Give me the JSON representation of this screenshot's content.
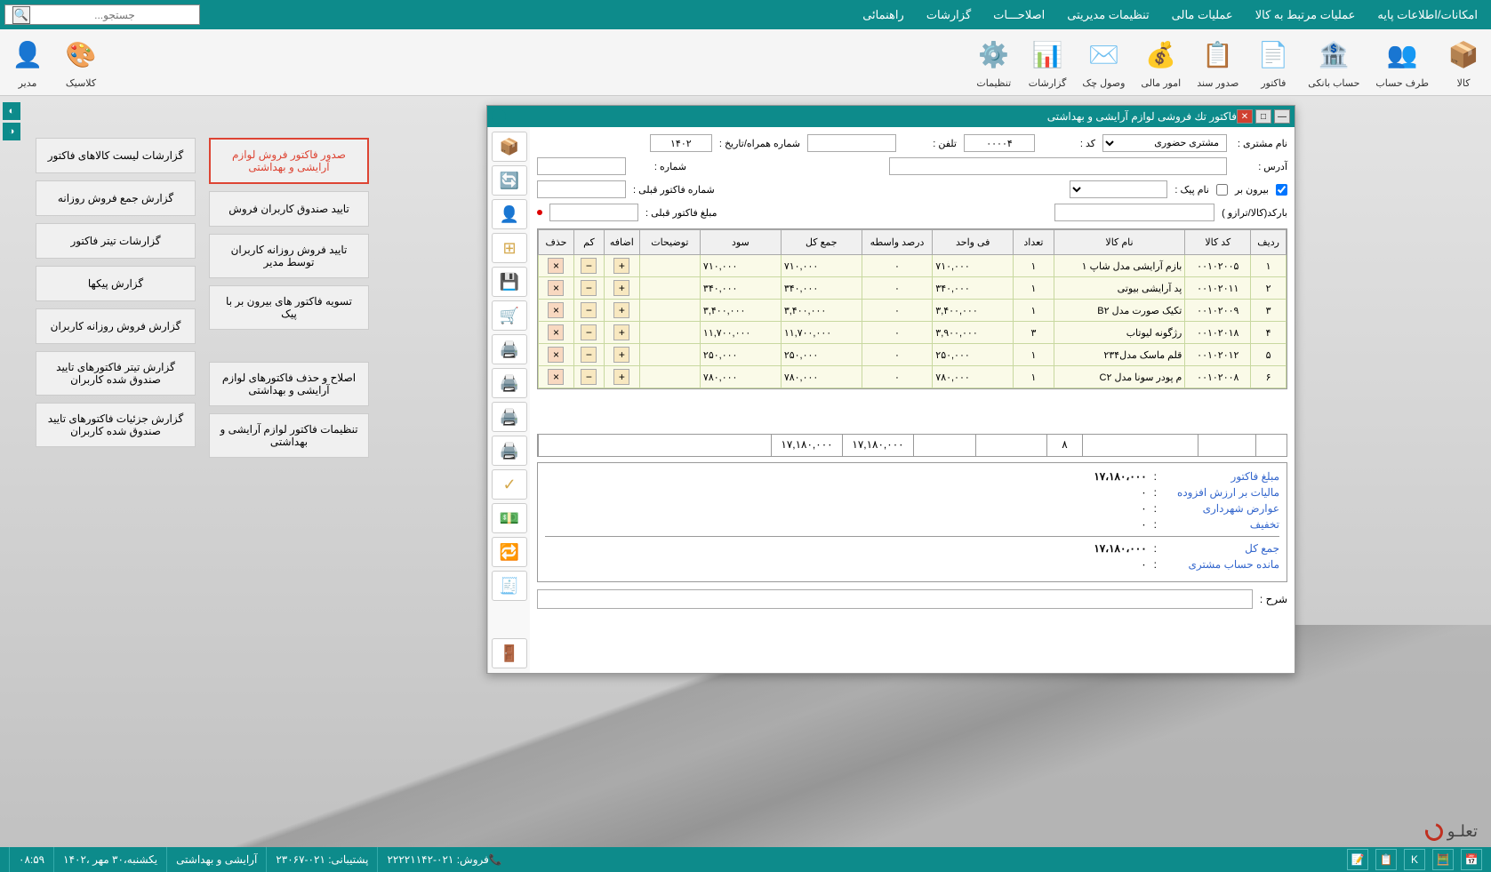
{
  "topMenu": [
    "امکانات/اطلاعات پایه",
    "عملیات مرتبط به کالا",
    "عملیات مالی",
    "تنظیمات مدیریتی",
    "اصلاحـــات",
    "گزارشات",
    "راهنمائی"
  ],
  "searchPlaceholder": "جستجو...",
  "ribbon": [
    {
      "label": "کالا",
      "icon": "📦"
    },
    {
      "label": "طرف حساب",
      "icon": "👥"
    },
    {
      "label": "حساب بانکی",
      "icon": "🏦"
    },
    {
      "label": "فاکتور",
      "icon": "📄"
    },
    {
      "label": "صدور سند",
      "icon": "📋"
    },
    {
      "label": "امور مالی",
      "icon": "💰"
    },
    {
      "label": "وصول چک",
      "icon": "✉️"
    },
    {
      "label": "گزارشات",
      "icon": "📊"
    },
    {
      "label": "تنظیمات",
      "icon": "⚙️"
    }
  ],
  "ribbonLeft": [
    {
      "label": "کلاسیک",
      "icon": "🎨"
    },
    {
      "label": "مدیر",
      "icon": "👤"
    }
  ],
  "leftPanelCol1": [
    {
      "label": "صدور فاکتور فروش لوازم آرایشی و بهداشتی",
      "highlighted": true
    },
    {
      "label": "تایید صندوق کاربران فروش"
    },
    {
      "label": "تایید فروش روزانه کاربران توسط مدیر"
    },
    {
      "label": "تسویه فاکتور های بیرون بر با پیک"
    },
    {
      "label": "اصلاح و حذف فاکتورهای لوازم آرایشی و بهداشتی"
    },
    {
      "label": "تنظیمات فاکتور لوازم آرایشی و بهداشتی"
    }
  ],
  "leftPanelCol2": [
    {
      "label": "گزارشات لیست کالاهای فاکتور"
    },
    {
      "label": "گزارش جمع فروش روزانه"
    },
    {
      "label": "گزارشات تیتر فاکتور"
    },
    {
      "label": "گزارش پیکها"
    },
    {
      "label": "گزارش فروش روزانه کاربران"
    },
    {
      "label": "گزارش تیتر فاکتورهای تایید صندوق شده کاربران"
    },
    {
      "label": "گزارش جزئیات فاکتورهای تایید صندوق شده کاربران"
    }
  ],
  "windowTitle": "فاکتور تك فروشی لوازم آرایشی و بهداشتی",
  "header": {
    "customerNameLabel": "نام مشتری :",
    "customerName": "مشتری حضوری",
    "codeLabel": "کد     :",
    "code": "۰۰۰۰۴",
    "phoneLabel": "تلفن :",
    "phone": "",
    "mobileLabel": "شماره همراه/تاریخ     :",
    "date": "۱۴۰۲",
    "addressLabel": "آدرس     :",
    "address": "",
    "numberLabel": "شماره     :",
    "number": "",
    "outsideLabel": "بیرون بر",
    "courierNameLabel": "نام پیک :",
    "prevInvoiceLabel": "شماره فاکتور قبلی :",
    "barcodeLabel": "بارکد(کالا/ترازو )",
    "prevAmountLabel": "مبلغ فاکتور قبلی :"
  },
  "tableHeaders": [
    "ردیف",
    "کد کالا",
    "نام کالا",
    "تعداد",
    "فی واحد",
    "درصد واسطه",
    "جمع کل",
    "سود",
    "توضیحات",
    "اضافه",
    "کم",
    "حذف"
  ],
  "rows": [
    {
      "r": "۱",
      "code": "۰۰۱۰۲۰۰۵",
      "name": "بازم آرایشی مدل شاپ ۱",
      "qty": "۱",
      "unit": "۷۱۰,۰۰۰",
      "pct": "۰",
      "total": "۷۱۰,۰۰۰",
      "profit": "۷۱۰,۰۰۰"
    },
    {
      "r": "۲",
      "code": "۰۰۱۰۲۰۱۱",
      "name": "پد آرایشی بیوتی",
      "qty": "۱",
      "unit": "۳۴۰,۰۰۰",
      "pct": "۰",
      "total": "۳۴۰,۰۰۰",
      "profit": "۳۴۰,۰۰۰"
    },
    {
      "r": "۳",
      "code": "۰۰۱۰۲۰۰۹",
      "name": "تکیک صورت مدل B۲",
      "qty": "۱",
      "unit": "۳,۴۰۰,۰۰۰",
      "pct": "۰",
      "total": "۳,۴۰۰,۰۰۰",
      "profit": "۳,۴۰۰,۰۰۰"
    },
    {
      "r": "۴",
      "code": "۰۰۱۰۲۰۱۸",
      "name": "رژگونه لیوتاب",
      "qty": "۳",
      "unit": "۳,۹۰۰,۰۰۰",
      "pct": "۰",
      "total": "۱۱,۷۰۰,۰۰۰",
      "profit": "۱۱,۷۰۰,۰۰۰"
    },
    {
      "r": "۵",
      "code": "۰۰۱۰۲۰۱۲",
      "name": "قلم ماسک مدل۲۳۴",
      "qty": "۱",
      "unit": "۲۵۰,۰۰۰",
      "pct": "۰",
      "total": "۲۵۰,۰۰۰",
      "profit": "۲۵۰,۰۰۰"
    },
    {
      "r": "۶",
      "code": "۰۰۱۰۲۰۰۸",
      "name": "م پودر سونا مدل C۲",
      "qty": "۱",
      "unit": "۷۸۰,۰۰۰",
      "pct": "۰",
      "total": "۷۸۰,۰۰۰",
      "profit": "۷۸۰,۰۰۰"
    }
  ],
  "totals": {
    "qty": "۸",
    "sum1": "۱۷,۱۸۰,۰۰۰",
    "sum2": "۱۷,۱۸۰,۰۰۰"
  },
  "summary": {
    "invoiceAmountLabel": "مبلغ فاکتور",
    "invoiceAmount": "۱۷،۱۸۰،۰۰۰",
    "vatLabel": "مالیات بر ارزش افزوده",
    "vat": "۰",
    "municipalLabel": "عوارض شهرداری",
    "municipal": "۰",
    "discountLabel": "تخفیف",
    "discount": "۰",
    "grandLabel": "جمع کل",
    "grand": "۱۷،۱۸۰،۰۰۰",
    "balanceLabel": "مانده حساب مشتری",
    "balance": "۰"
  },
  "descLabel": "شرح :",
  "statusBar": {
    "sales": "فروش:   ۰۲۱-۲۲۲۲۱۱۴۲",
    "support": "پشتیبانی:   ۰۲۱-۲۳۰۶۷",
    "company": "آرایشی و بهداشتی",
    "date": "یکشنبه،۳۰ مهر ،۱۴۰۲",
    "time": "۰۸:۵۹"
  },
  "brand": "تعلـو"
}
